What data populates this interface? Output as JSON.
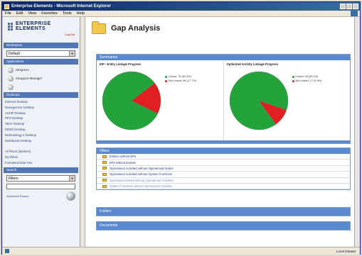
{
  "window": {
    "title": "Enterprise Elements - Microsoft Internet Explorer"
  },
  "menu": [
    "File",
    "Edit",
    "View",
    "Favorites",
    "Tools",
    "Help"
  ],
  "sidebar": {
    "logo_line1": "ENTERPRISE",
    "logo_line2": "ELEMENTS",
    "logout": "Log Out",
    "workspace_head": "Workspace",
    "workspace_value": "Default",
    "applications_head": "Applications",
    "apps": [
      "eExpress",
      "eSupport Manager",
      ""
    ],
    "desktops_head": "Desktops",
    "links": [
      "Element Desktop",
      "Management Desktop",
      "ArchiP Desktop",
      "PPO Desktop",
      "TBAF Desktop",
      "DMSS Desktop",
      "Methodology 4 Desktop",
      "Dashboard Desktop"
    ],
    "extra_links": [
      "All Filters (Markers)",
      "My Filters",
      "Formatted Data Tree"
    ],
    "search_head": "Search",
    "search_select": "Filters",
    "advanced_search": "Advanced Search"
  },
  "page": {
    "title": "Gap Analysis"
  },
  "summaries": {
    "head": "Summaries",
    "charts": [
      {
        "title": "EIP - Entity Linkage Progress",
        "legend": [
          "Linked: 76 (82.3%)",
          "Not Linked: 98 (17.7%)"
        ]
      },
      {
        "title": "Optimized Activity Linkage Progress",
        "legend": [
          "Linked: 94 (80.1%)",
          "Not Linked: 17 (9.9%)"
        ]
      }
    ]
  },
  "chart_data": [
    {
      "type": "pie",
      "title": "EIP - Entity Linkage Progress",
      "categories": [
        "Linked",
        "Not Linked"
      ],
      "values": [
        82.3,
        17.7
      ],
      "colors": [
        "#22a43a",
        "#e02020"
      ]
    },
    {
      "type": "pie",
      "title": "Optimized Activity Linkage Progress",
      "categories": [
        "Linked",
        "Not Linked"
      ],
      "values": [
        90.1,
        9.9
      ],
      "colors": [
        "#22a43a",
        "#e02020"
      ]
    }
  ],
  "filters": {
    "head": "Filters",
    "items": [
      "Entities without EPs",
      "EPs without Entities",
      "Operational Activities without Operational Nodes",
      "Operational Activities without System Functions",
      "Operational Nodes without Operational Activities",
      "System Functions without Operational Activities"
    ]
  },
  "folders": {
    "head": "Folders"
  },
  "documents": {
    "head": "Documents"
  },
  "statusbar": {
    "zone": "Local intranet"
  }
}
